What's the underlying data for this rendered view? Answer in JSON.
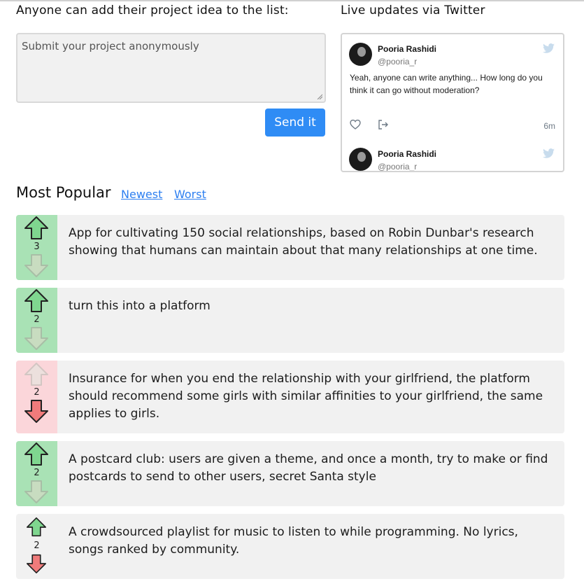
{
  "submit": {
    "heading": "Anyone can add their project idea to the list:",
    "placeholder": "Submit your project anonymously",
    "send_label": "Send it"
  },
  "twitter": {
    "heading": "Live updates via Twitter",
    "tweets": [
      {
        "name": "Pooria Rashidi",
        "handle": "@pooria_r",
        "text": "Yeah, anyone can write anything... How long do you think it can go without moderation?",
        "time": "6m"
      },
      {
        "name": "Pooria Rashidi",
        "handle": "@pooria_r"
      }
    ]
  },
  "tabs": {
    "active": "Most Popular",
    "newest": "Newest",
    "worst": "Worst"
  },
  "ideas": [
    {
      "score": "3",
      "vote": "up",
      "text": "App for cultivating 150 social relationships, based on Robin Dunbar's research showing that humans can maintain about that many relationships at one time."
    },
    {
      "score": "2",
      "vote": "up",
      "text": "turn this into a platform"
    },
    {
      "score": "2",
      "vote": "down",
      "text": "Insurance for when you end the relationship with your girlfriend, the platform should recommend some girls with similar affinities to your girlfriend, the same applies to girls."
    },
    {
      "score": "2",
      "vote": "up",
      "text": "A postcard club: users are given a theme, and once a month, try to make or find postcards to send to other users, secret Santa style"
    },
    {
      "score": "2",
      "vote": "none",
      "text": "A crowdsourced playlist for music to listen to while programming. No lyrics, songs ranked by community."
    }
  ],
  "icons": {
    "upvote": "up-arrow-icon",
    "downvote": "down-arrow-icon",
    "like": "heart-icon",
    "share": "share-icon",
    "twitter": "twitter-bird-icon"
  },
  "colors": {
    "send_button": "#2f8cf5",
    "link": "#2d7ff0",
    "upvoted_bg": "#a9e2b5",
    "downvoted_bg": "#fbd6da",
    "card_bg": "#f1f1f1",
    "arrow_green": "#7fd68f",
    "arrow_red": "#f07b7b"
  }
}
